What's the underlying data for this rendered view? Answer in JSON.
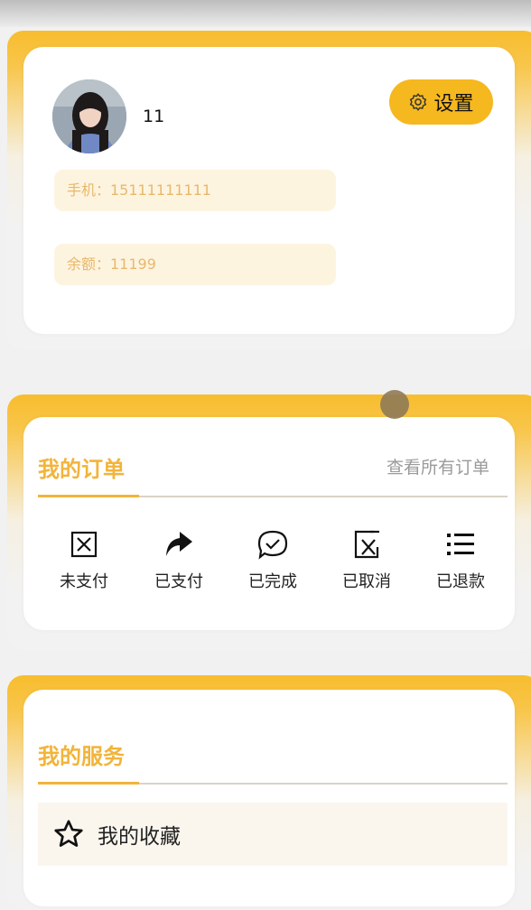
{
  "profile": {
    "username": "11",
    "settings_label": "设置",
    "phone": "手机：15111111111",
    "balance": "余额：11199"
  },
  "orders": {
    "title": "我的订单",
    "view_all": "查看所有订单",
    "items": [
      {
        "label": "未支付",
        "icon": "unpaid-icon"
      },
      {
        "label": "已支付",
        "icon": "paid-share-icon"
      },
      {
        "label": "已完成",
        "icon": "completed-check-icon"
      },
      {
        "label": "已取消",
        "icon": "cancelled-icon"
      },
      {
        "label": "已退款",
        "icon": "refund-list-icon"
      }
    ]
  },
  "services": {
    "title": "我的服务",
    "items": [
      {
        "label": "我的收藏",
        "icon": "star-icon"
      }
    ]
  },
  "colors": {
    "accent": "#f6b81f",
    "accent_text": "#f2b43a",
    "pill_bg": "#fdf4e0",
    "pill_text": "#e8b86a"
  }
}
